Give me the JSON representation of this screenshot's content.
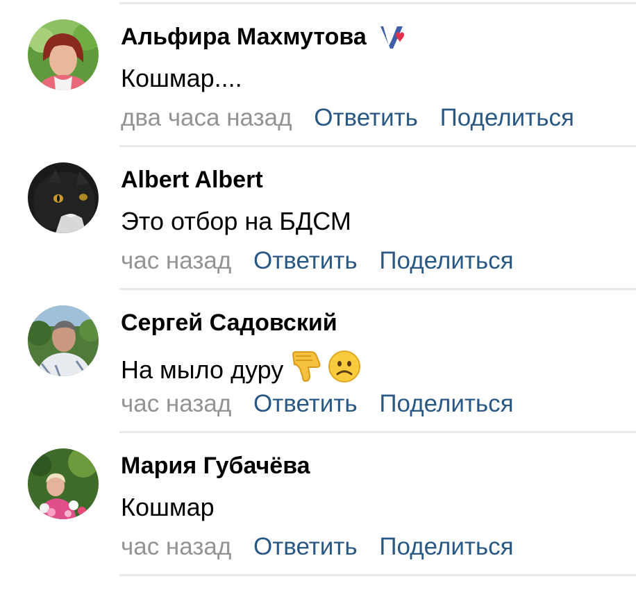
{
  "comments": [
    {
      "author": "Альфира Махмутова",
      "text": "Кошмар....",
      "time": "два часа назад",
      "reply_label": "Ответить",
      "share_label": "Поделиться",
      "badge": "vote-ribbon-icon"
    },
    {
      "author": "Albert Albert",
      "text": "Это отбор на БДСМ",
      "time": "час назад",
      "reply_label": "Ответить",
      "share_label": "Поделиться"
    },
    {
      "author": "Сергей Садовский",
      "text": "На мыло дуру",
      "time": "час назад",
      "reply_label": "Ответить",
      "share_label": "Поделиться",
      "emojis": [
        "thumbs-down-icon",
        "sad-face-icon"
      ]
    },
    {
      "author": "Мария Губачёва",
      "text": "Кошмар",
      "time": "час назад",
      "reply_label": "Ответить",
      "share_label": "Поделиться"
    }
  ],
  "colors": {
    "link": "#2a5885",
    "muted": "#939393",
    "divider": "#e7e8ec"
  }
}
